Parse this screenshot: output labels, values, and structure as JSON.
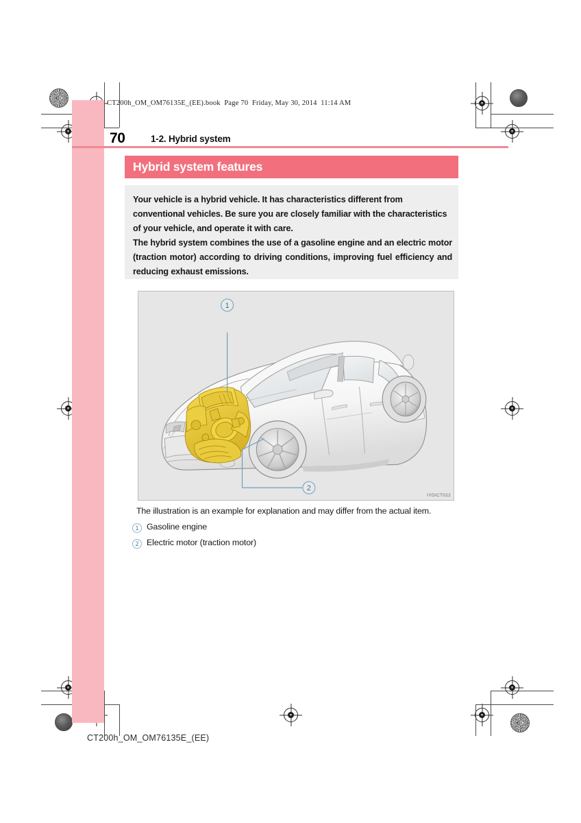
{
  "print_header": "CT200h_OM_OM76135E_(EE).book  Page 70  Friday, May 30, 2014  11:14 AM",
  "page_number": "70",
  "chapter_title": "1-2. Hybrid system",
  "section_title": "Hybrid system features",
  "intro": {
    "paragraph_1": "Your vehicle is a hybrid vehicle. It has characteristics different from conventional vehicles. Be sure you are closely familiar with the characteristics of your vehicle, and operate it with care.",
    "paragraph_2": "The hybrid system combines the use of a gasoline engine and an electric motor (traction motor) according to driving conditions, improving fuel efficiency and reducing exhaust emissions."
  },
  "figure": {
    "image_code": "IYDICT022",
    "caption": "The illustration is an example for explanation and may differ from the actual item.",
    "callouts": [
      {
        "number": "1",
        "label": "Gasoline engine"
      },
      {
        "number": "2",
        "label": "Electric motor (traction motor)"
      }
    ],
    "alt": "Cutaway illustration of a hybrid hatchback showing the gasoline engine and electric traction motor highlighted in yellow inside the engine compartment"
  },
  "footer": "CT200h_OM_OM76135E_(EE)",
  "colors": {
    "accent_band": "#f2707e",
    "head_rule": "#ef8a96",
    "tab": "#f9b8c0",
    "intro_bg": "#eeeeee",
    "figure_bg": "#e6e6e6",
    "callout": "#7ca9c6",
    "highlight_part": "#e8c83c"
  }
}
